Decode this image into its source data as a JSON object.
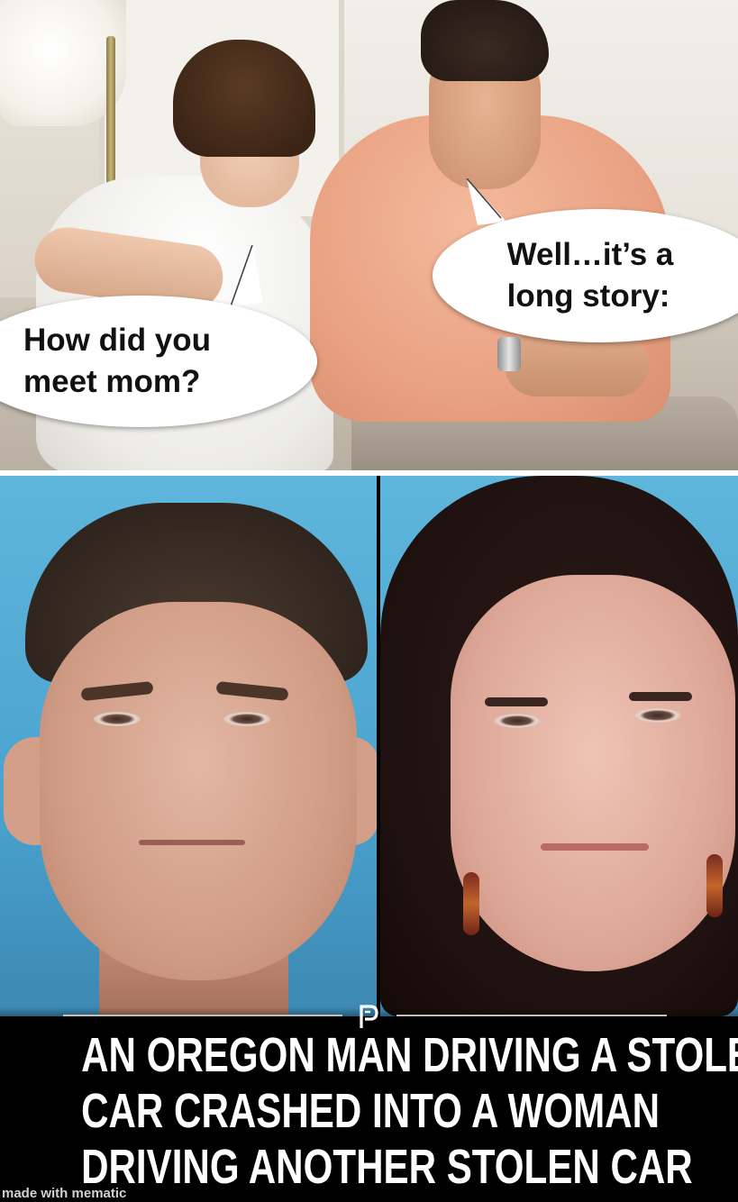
{
  "top_panel": {
    "bubble_left_text": "How did you\nmeet mom?",
    "bubble_right_text": "Well…it’s a\nlong story:"
  },
  "bottom_panel": {
    "headline_lines": [
      "AN OREGON MAN DRIVING A STOLEN",
      "CAR CRASHED INTO A WOMAN",
      "DRIVING ANOTHER STOLEN CAR"
    ]
  },
  "watermark": "made with mematic",
  "colors": {
    "bubble": "#ffffff",
    "bubble_text": "#111111",
    "headline": "#ffffff",
    "caption_background": "#000000",
    "photo_background": "#5fb6dc"
  }
}
